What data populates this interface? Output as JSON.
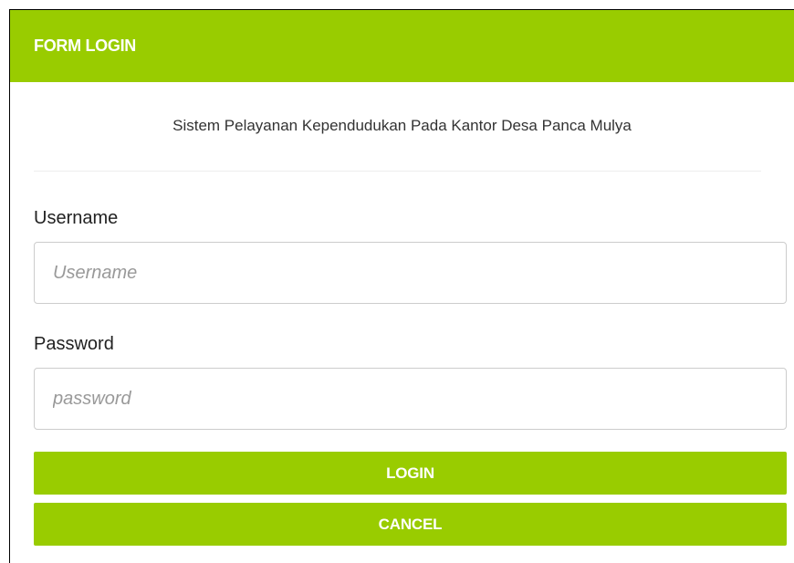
{
  "header": {
    "title": "FORM LOGIN"
  },
  "subtitle": "Sistem Pelayanan Kependudukan Pada Kantor Desa Panca Mulya",
  "form": {
    "username_label": "Username",
    "username_placeholder": "Username",
    "username_value": "",
    "password_label": "Password",
    "password_placeholder": "password",
    "password_value": ""
  },
  "buttons": {
    "login_label": "LOGIN",
    "cancel_label": "CANCEL"
  },
  "colors": {
    "accent": "#99cc00",
    "button_text": "#ffffff"
  }
}
